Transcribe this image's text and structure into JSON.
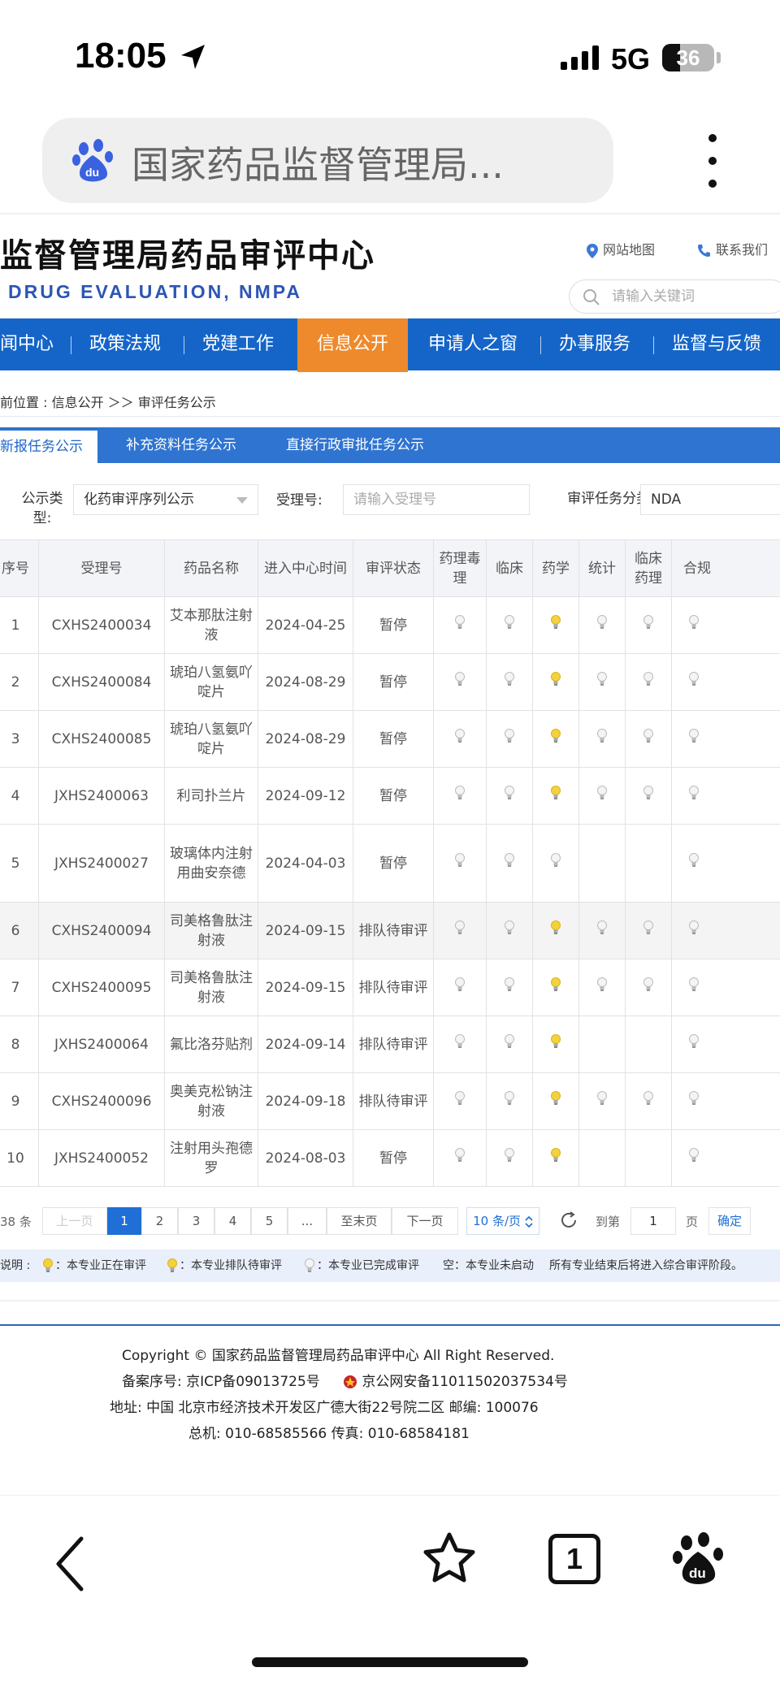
{
  "status_bar": {
    "time": "18:05",
    "network": "5G",
    "battery": "36"
  },
  "browser": {
    "url_text": "国家药品监督管理局..."
  },
  "site": {
    "title": "监督管理局药品审评中心",
    "subtitle": "DRUG EVALUATION, NMPA",
    "links": {
      "sitemap": "网站地图",
      "contact": "联系我们"
    },
    "search_placeholder": "请输入关键词"
  },
  "nav": {
    "items": [
      "闻中心",
      "政策法规",
      "党建工作",
      "信息公开",
      "申请人之窗",
      "办事服务",
      "监督与反馈"
    ],
    "active": "信息公开"
  },
  "breadcrumb": "前位置 : 信息公开 ＞＞ 审评任务公示",
  "tabs": [
    "新报任务公示",
    "补充资料任务公示",
    "直接行政审批任务公示"
  ],
  "filters": {
    "type_label": "公示类型:",
    "type_value": "化药审评序列公示",
    "accept_label": "受理号:",
    "accept_placeholder": "请输入受理号",
    "category_label": "审评任务分类:",
    "category_value": "NDA"
  },
  "table": {
    "headers": [
      "序号",
      "受理号",
      "药品名称",
      "进入中心时间",
      "审评状态",
      "药理毒理",
      "临床",
      "药学",
      "统计",
      "临床药理",
      "合规"
    ],
    "rows": [
      {
        "no": "1",
        "id": "CXHS2400034",
        "name": "艾本那肽注射液",
        "date": "2024-04-25",
        "status": "暂停",
        "icons": [
          "done",
          "done",
          "pending",
          "done",
          "done",
          "done"
        ]
      },
      {
        "no": "2",
        "id": "CXHS2400084",
        "name": "琥珀八氢氨吖啶片",
        "date": "2024-08-29",
        "status": "暂停",
        "icons": [
          "done",
          "done",
          "pending",
          "done",
          "done",
          "done"
        ]
      },
      {
        "no": "3",
        "id": "CXHS2400085",
        "name": "琥珀八氢氨吖啶片",
        "date": "2024-08-29",
        "status": "暂停",
        "icons": [
          "done",
          "done",
          "pending",
          "done",
          "done",
          "done"
        ]
      },
      {
        "no": "4",
        "id": "JXHS2400063",
        "name": "利司扑兰片",
        "date": "2024-09-12",
        "status": "暂停",
        "icons": [
          "done",
          "done",
          "pending",
          "done",
          "done",
          "done"
        ]
      },
      {
        "no": "5",
        "id": "JXHS2400027",
        "name": "玻璃体内注射用曲安奈德",
        "date": "2024-04-03",
        "status": "暂停",
        "icons": [
          "done",
          "done",
          "done",
          "",
          "",
          "done"
        ]
      },
      {
        "no": "6",
        "id": "CXHS2400094",
        "name": "司美格鲁肽注射液",
        "date": "2024-09-15",
        "status": "排队待审评",
        "icons": [
          "done",
          "done",
          "pending",
          "done",
          "done",
          "done"
        ]
      },
      {
        "no": "7",
        "id": "CXHS2400095",
        "name": "司美格鲁肽注射液",
        "date": "2024-09-15",
        "status": "排队待审评",
        "icons": [
          "done",
          "done",
          "pending",
          "done",
          "done",
          "done"
        ]
      },
      {
        "no": "8",
        "id": "JXHS2400064",
        "name": "氟比洛芬贴剂",
        "date": "2024-09-14",
        "status": "排队待审评",
        "icons": [
          "done",
          "done",
          "pending",
          "",
          "",
          "done"
        ]
      },
      {
        "no": "9",
        "id": "CXHS2400096",
        "name": "奥美克松钠注射液",
        "date": "2024-09-18",
        "status": "排队待审评",
        "icons": [
          "done",
          "done",
          "pending",
          "done",
          "done",
          "done"
        ]
      },
      {
        "no": "10",
        "id": "JXHS2400052",
        "name": "注射用头孢德罗",
        "date": "2024-08-03",
        "status": "暂停",
        "icons": [
          "done",
          "done",
          "pending",
          "",
          "",
          "done"
        ]
      }
    ]
  },
  "pager": {
    "total": "38 条",
    "prev": "上一页",
    "pages": [
      "1",
      "2",
      "3",
      "4",
      "5",
      "..."
    ],
    "last": "至末页",
    "next": "下一页",
    "page_size": "10 条/页",
    "goto_label": "到第",
    "goto_value": "1",
    "page_unit": "页",
    "confirm": "确定"
  },
  "legend": {
    "label": "说明 :",
    "reviewing": "：本专业正在审评",
    "queued": "：本专业排队待审评",
    "done": "：本专业已完成审评",
    "empty": "空：本专业未启动",
    "note": "所有专业结束后将进入综合审评阶段。"
  },
  "footer": {
    "copyright": "Copyright © 国家药品监督管理局药品审评中心    All Right Reserved.",
    "icp": "备案序号:  京ICP备09013725号",
    "police": "京公网安备11011502037534号",
    "address": "地址:  中国  北京市经济技术开发区广德大街22号院二区      邮编:  100076",
    "phone": "总机:  010-68585566      传真:  010-68584181"
  },
  "bottom_bar": {
    "tabs_count": "1"
  },
  "colors": {
    "nav_blue": "#1565c9",
    "nav_active": "#ee8a2c",
    "tab_blue": "#2f74d0",
    "bulb_yellow": "#f3d23c"
  }
}
